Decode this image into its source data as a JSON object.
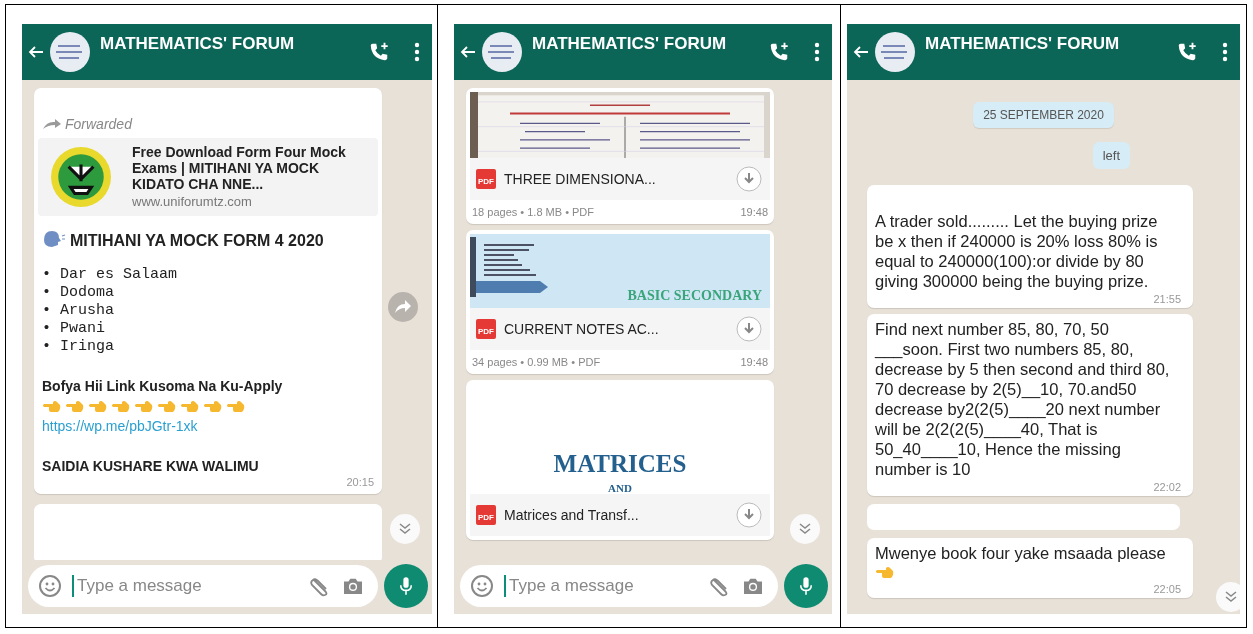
{
  "panels": [
    {
      "header": {
        "title": "MATHEMATICS' FORUM"
      },
      "messages": [
        {
          "kind": "post",
          "forwarded": "Forwarded",
          "preview": {
            "title": "Free Download Form Four Mock Exams | MITIHANI YA MOCK KIDATO CHA NNE...",
            "domain": "www.uniforumtz.com"
          },
          "heading": "MITIHANI YA MOCK FORM 4 2020",
          "items": [
            "• Dar es Salaam",
            "• Dodoma",
            "• Arusha",
            "• Pwani",
            "• Iringa"
          ],
          "call": "Bofya Hii Link Kusoma Na Ku-Apply",
          "link": "https://wp.me/pbJGtr-1xk",
          "footer": "SAIDIA KUSHARE KWA WALIMU",
          "time": "20:15"
        },
        {
          "kind": "redacted"
        }
      ],
      "composer": {
        "placeholder": "Type a message"
      }
    },
    {
      "header": {
        "title": "MATHEMATICS' FORUM"
      },
      "messages": [
        {
          "kind": "document",
          "badge": "PDF",
          "file": "THREE DIMENSIONA...",
          "meta": "18 pages • 1.8 MB • PDF",
          "time": "19:48"
        },
        {
          "kind": "document",
          "thumbnail": {
            "kind": "cover",
            "caption": "BASIC SECONDARY"
          },
          "badge": "PDF",
          "file": "CURRENT NOTES AC...",
          "meta": "34 pages • 0.99 MB • PDF",
          "time": "19:48"
        },
        {
          "kind": "document",
          "thumbnail": {
            "kind": "title",
            "title": "MATRICES",
            "subtitle": "AND"
          },
          "badge": "PDF",
          "file": "Matrices and Transf..."
        }
      ],
      "composer": {
        "placeholder": "Type a message"
      }
    },
    {
      "header": {
        "title": "MATHEMATICS' FORUM"
      },
      "messages": [
        {
          "kind": "date",
          "text": "25 SEPTEMBER 2020"
        },
        {
          "kind": "outgoing",
          "text": "left"
        },
        {
          "kind": "text",
          "text": "A trader sold......... Let the buying prize be x then if 240000 is 20% loss 80% is equal to 240000(100):or divide by 80 giving 300000 being the buying prize.",
          "time": "21:55",
          "pointing_hand": false
        },
        {
          "kind": "text",
          "text": "Find next number 85, 80, 70, 50 ___soon. First two numbers 85, 80, decrease by 5 then second and third 80, 70 decrease by 2(5)__10, 70.and50 decrease by2(2(5)____20 next number will be 2(2(2(5)____40, That is 50_40____10, Hence the missing number is 10",
          "time": "22:02",
          "pointing_hand": false
        },
        {
          "kind": "redacted"
        },
        {
          "kind": "text",
          "text": "Mwenye book four yake msaada please",
          "time": "22:05",
          "pointing_hand": true
        }
      ]
    }
  ]
}
